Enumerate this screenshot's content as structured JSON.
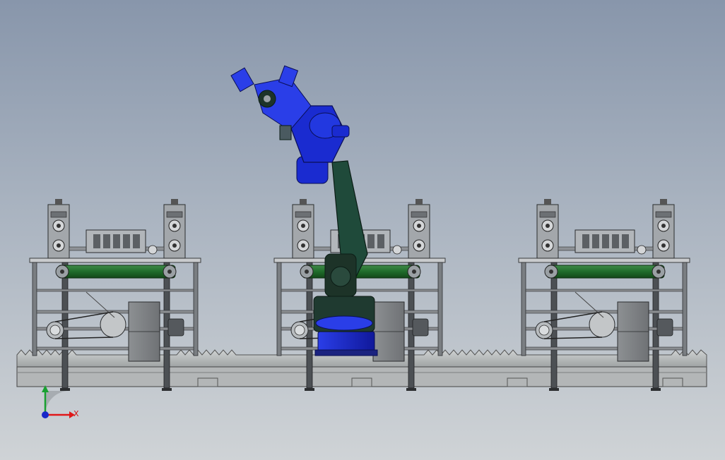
{
  "viewport": {
    "background_top": "#8896ab",
    "background_bottom": "#cfd3d6"
  },
  "triad": {
    "x_label": "X",
    "x_color": "#e01818",
    "y_color": "#18a030",
    "z_color": "#1828c8"
  },
  "assembly": {
    "stations": [
      "station-left",
      "station-center",
      "station-right"
    ],
    "roller_color": "#1f6b2a",
    "frame_color": "#6e7278",
    "robot_color": "#1a2bd0",
    "robot_arm_color": "#1f4a3a",
    "rail_color": "#b9bcbc"
  }
}
